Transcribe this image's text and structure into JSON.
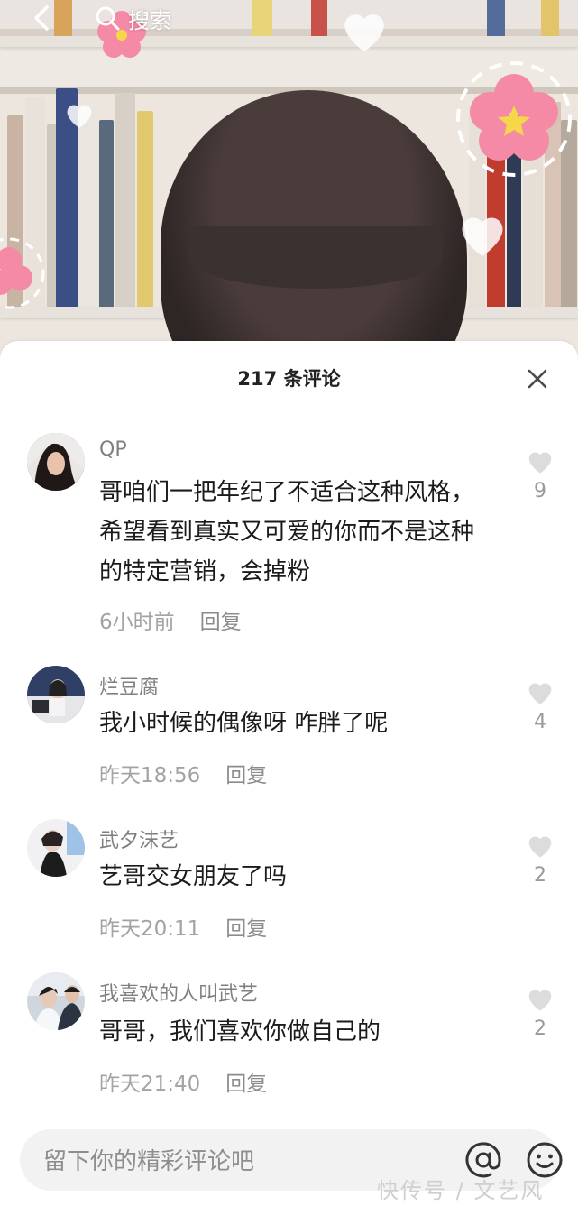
{
  "topbar": {
    "search_label": "搜索"
  },
  "sheet": {
    "title": "217 条评论"
  },
  "comments": [
    {
      "username": "QP",
      "content": "哥咱们一把年纪了不适合这种风格， 希望看到真实又可爱的你而不是这种的特定营销，会掉粉",
      "time": "6小时前",
      "reply": "回复",
      "likes": "9"
    },
    {
      "username": "烂豆腐",
      "content": "我小时候的偶像呀 咋胖了呢",
      "time": "昨天18:56",
      "reply": "回复",
      "likes": "4"
    },
    {
      "username": "武夕沫艺",
      "content": "艺哥交女朋友了吗",
      "time": "昨天20:11",
      "reply": "回复",
      "likes": "2"
    },
    {
      "username": "我喜欢的人叫武艺",
      "content": "哥哥，我们喜欢你做自己的",
      "time": "昨天21:40",
      "reply": "回复",
      "likes": "2"
    }
  ],
  "input": {
    "placeholder": "留下你的精彩评论吧"
  },
  "icons": {
    "back": "chevron-left-icon",
    "search": "search-icon",
    "close": "close-icon",
    "heart": "heart-icon",
    "at": "at-icon",
    "emoji": "emoji-icon"
  },
  "colors": {
    "heart": "#dcdcdc",
    "sticker_flower": "#f58aa6"
  },
  "watermark": "快传号 / 文艺风"
}
